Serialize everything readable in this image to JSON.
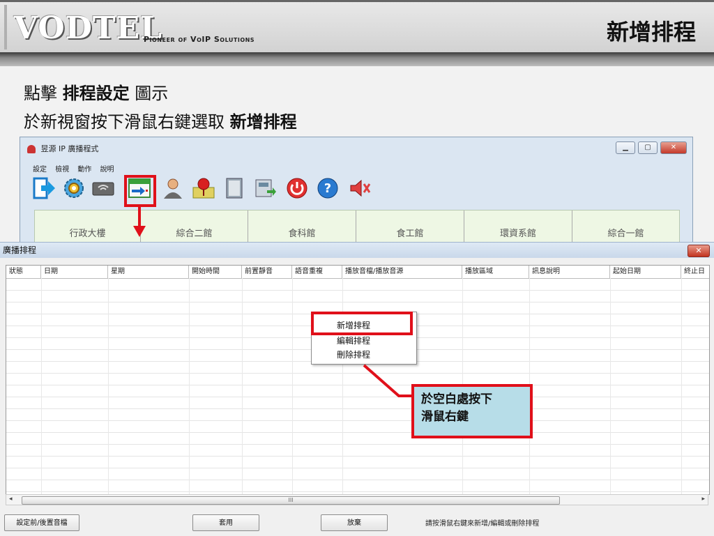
{
  "header": {
    "logo": "VODTEL",
    "tagline": "Pioneer of VoIP Solutions",
    "slide_title": "新增排程"
  },
  "instructions": {
    "line1_prefix": "點擊",
    "line1_bold": "排程設定",
    "line1_suffix": "圖示",
    "line2_prefix": "於新視窗按下滑鼠右鍵選取",
    "line2_bold": "新增排程"
  },
  "app_window": {
    "title": "昱源 IP 廣播程式",
    "menu": [
      "設定",
      "檢視",
      "動作",
      "說明"
    ],
    "toolbar_icons": [
      "exit-icon",
      "gear-icon",
      "device-icon",
      "schedule-icon",
      "user-icon",
      "pin-icon",
      "book-icon",
      "phone-icon",
      "power-icon",
      "help-icon",
      "speaker-icon"
    ],
    "tabs": [
      "行政大樓",
      "綜合二館",
      "食科館",
      "食工館",
      "環資系館",
      "綜合一館"
    ]
  },
  "dialog": {
    "title": "廣播排程",
    "close": "✕",
    "columns": [
      "狀態",
      "日期",
      "星期",
      "開始時間",
      "前置靜音",
      "語音重複",
      "播放音檔/播放音源",
      "播放區域",
      "訊息說明",
      "起始日期",
      "終止日"
    ],
    "scroll_thumb": "III",
    "buttons": {
      "pre_post": "設定前/後置音檔",
      "apply": "套用",
      "cancel": "放棄"
    },
    "status": "請按滑鼠右鍵來新增/編輯或刪除排程"
  },
  "context_menu": {
    "items": [
      "新增排程",
      "編輯排程",
      "刪除排程"
    ]
  },
  "callout": {
    "line1": "於空白處按下",
    "line2": "滑鼠右鍵"
  },
  "colors": {
    "highlight": "#e0101a",
    "callout_bg": "#b7dde8",
    "tab_bg": "#eef7e4"
  }
}
